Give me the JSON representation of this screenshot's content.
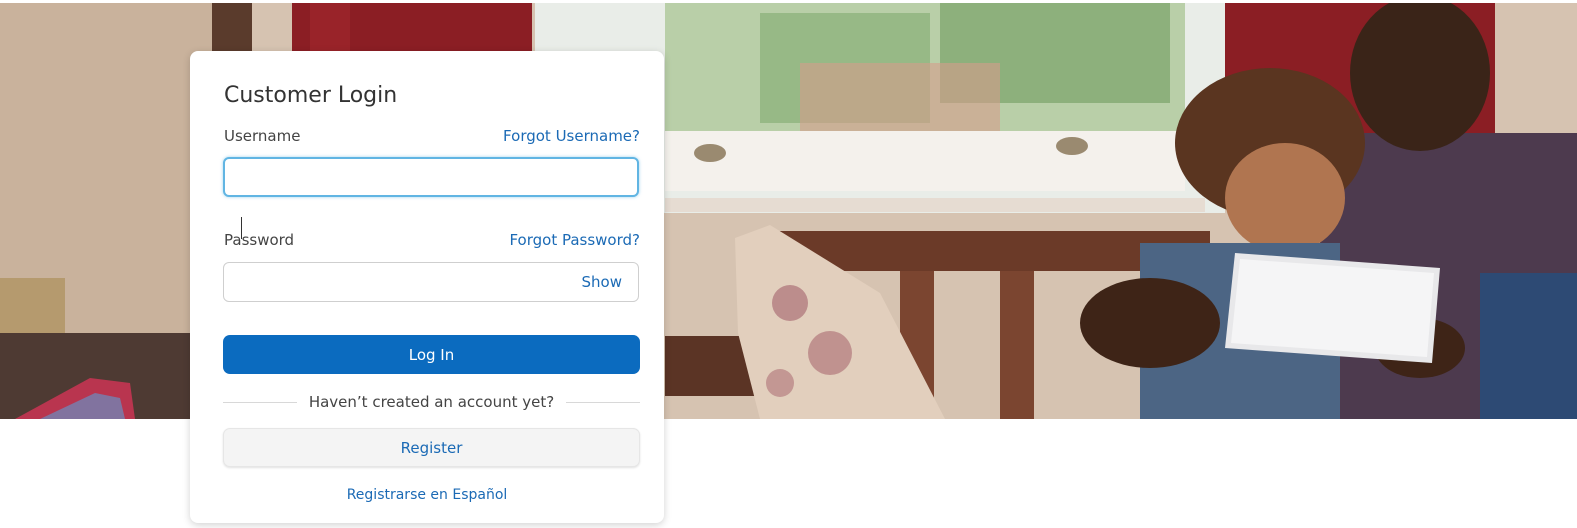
{
  "login": {
    "title": "Customer Login",
    "username_label": "Username",
    "forgot_username": "Forgot Username?",
    "username_value": "",
    "password_label": "Password",
    "forgot_password": "Forgot Password?",
    "password_value": "",
    "show_label": "Show",
    "login_button": "Log In",
    "no_account_text": "Haven’t created an account yet?",
    "register_button": "Register",
    "register_spanish": "Registrarse en Español"
  },
  "colors": {
    "primary_button": "#0b6bbf",
    "link": "#1b6ab5",
    "focus_border": "#61b5e3"
  }
}
